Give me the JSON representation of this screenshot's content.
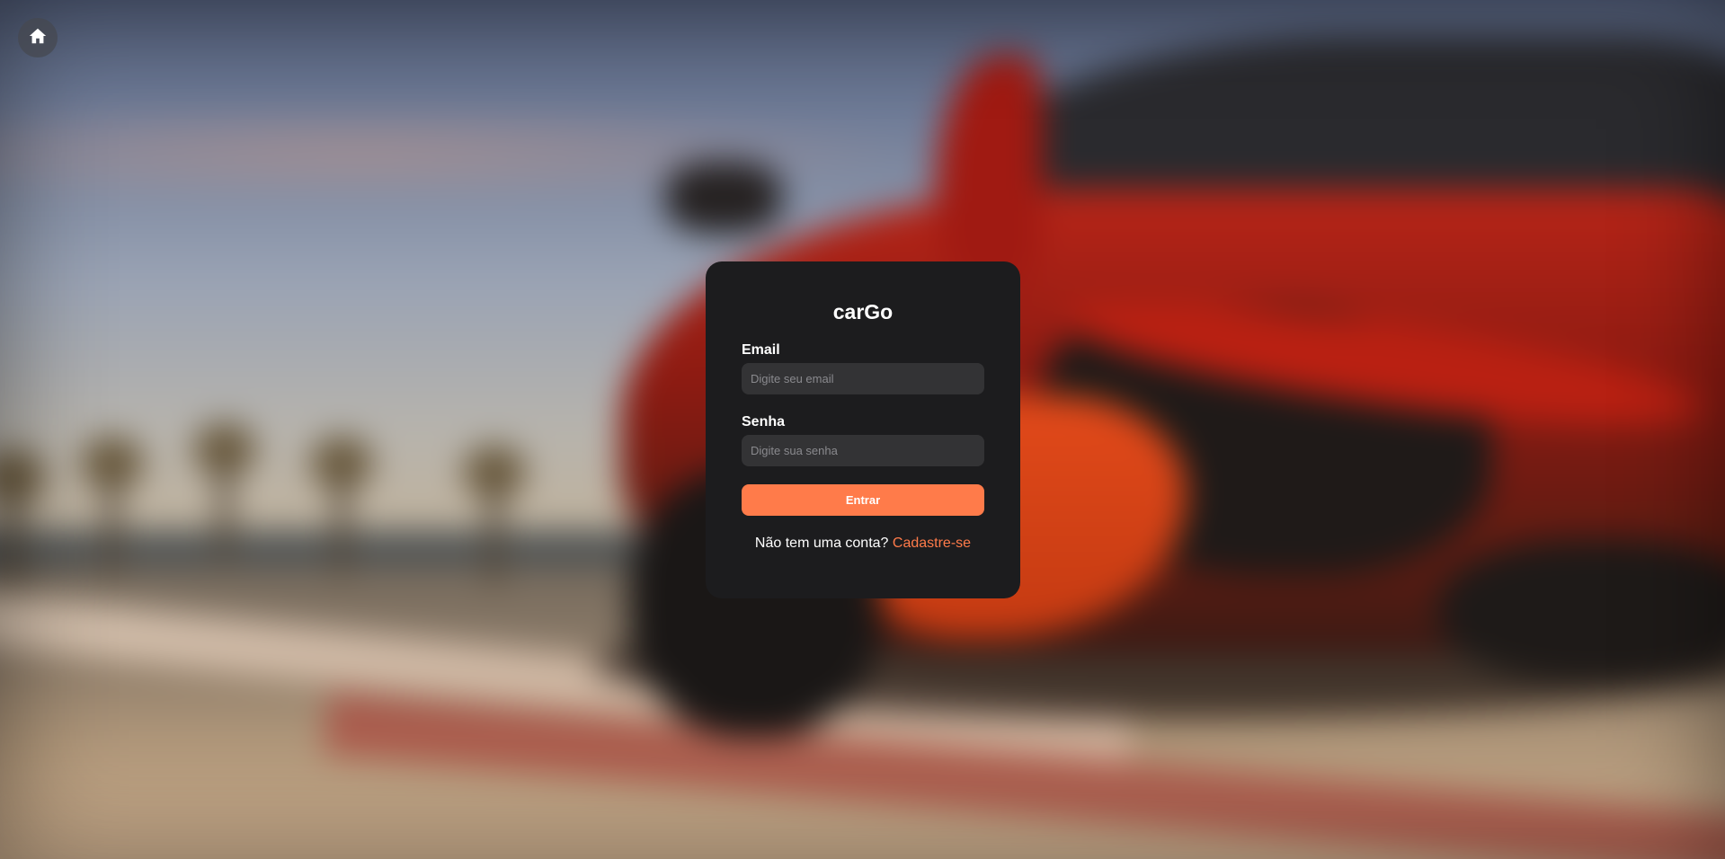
{
  "header": {
    "home_icon": "home-icon"
  },
  "login": {
    "brand": "carGo",
    "email_label": "Email",
    "email_placeholder": "Digite seu email",
    "email_value": "",
    "password_label": "Senha",
    "password_placeholder": "Digite sua senha",
    "password_value": "",
    "submit_label": "Entrar",
    "signup_prompt": "Não tem uma conta?",
    "signup_link": "Cadastre-se"
  },
  "colors": {
    "accent": "#ff7b4a",
    "card_background": "#1c1c1e",
    "input_background": "#333335",
    "text": "#ffffff"
  }
}
